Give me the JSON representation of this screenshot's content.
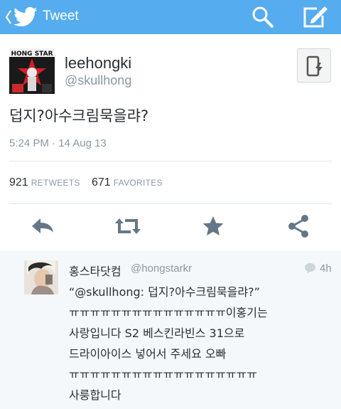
{
  "header": {
    "title": "Tweet",
    "back_icon": "chevron-left-icon",
    "logo_icon": "twitter-bird-icon",
    "search_icon": "search-icon",
    "compose_icon": "compose-icon",
    "bar_color": "#55acee"
  },
  "tweet": {
    "username": "leehongki",
    "handle": "@skullhong",
    "avatar_text": "HONG STAR",
    "text": "덥지?아수크림묵을랴?",
    "timestamp": "5:24 PM · 14 Aug 13",
    "retweets_count": "921",
    "retweets_label": "RETWEETS",
    "favorites_count": "671",
    "favorites_label": "FAVORITES",
    "follow_icon": "phone-alert-icon"
  },
  "actions": [
    {
      "name": "reply-button",
      "icon": "reply-icon"
    },
    {
      "name": "retweet-button",
      "icon": "retweet-icon"
    },
    {
      "name": "favorite-button",
      "icon": "star-icon"
    },
    {
      "name": "share-button",
      "icon": "share-icon"
    }
  ],
  "reply": {
    "name": "홍스타닷컴",
    "handle": "@hongstarkr",
    "time": "4h",
    "bubble_icon": "comment-bubble-icon",
    "lines": [
      "“@skullhong: 덥지?아수크림묵을랴?”",
      "ㅠㅠㅠㅠㅠㅠㅠㅠㅠㅠㅠㅠㅠㅠㅠ이홍기는",
      "사랑입니다 S2 베스킨라빈스 31으로",
      "드라이아이스 넣어서 주세요 오빠",
      "ㅠㅠㅠㅠㅠㅠㅠㅠㅠㅠㅠㅠㅠㅠㅠㅠㅠㅠ",
      "사룽합니다"
    ]
  }
}
